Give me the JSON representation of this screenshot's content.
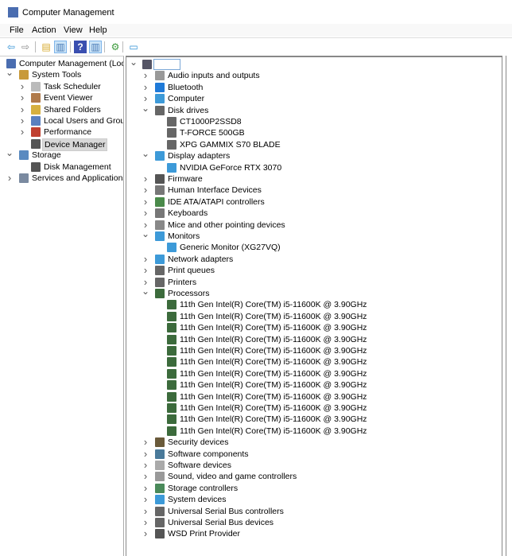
{
  "window": {
    "title": "Computer Management"
  },
  "menu": [
    "File",
    "Action",
    "View",
    "Help"
  ],
  "toolbar": [
    {
      "icon": "back-arrow-icon",
      "glyph": "⇦",
      "color": "#2d8fd5"
    },
    {
      "icon": "forward-arrow-icon",
      "glyph": "⇨",
      "color": "#888"
    },
    {
      "icon": "up-folder-icon",
      "glyph": "▤",
      "color": "#d6a82a"
    },
    {
      "icon": "show-hide-console-tree-icon",
      "glyph": "▥",
      "color": "#4a7bb7",
      "pressed": true
    },
    {
      "icon": "help-icon",
      "glyph": "?",
      "color": "#fff",
      "bg": "#3a4fb0"
    },
    {
      "icon": "show-hide-action-pane-icon",
      "glyph": "▥",
      "color": "#4a7bb7",
      "pressed": true
    },
    {
      "icon": "update-driver-icon",
      "glyph": "⚙",
      "color": "#3a9a3a"
    },
    {
      "icon": "scan-hardware-icon",
      "glyph": "▭",
      "color": "#2d8fd5"
    }
  ],
  "left_tree": [
    {
      "level": 0,
      "exp": "",
      "icon": "computer-management-icon",
      "color": "#4a6db0",
      "label": "Computer Management (Local"
    },
    {
      "level": 1,
      "exp": "open",
      "icon": "system-tools-icon",
      "color": "#c89a3a",
      "label": "System Tools"
    },
    {
      "level": 2,
      "exp": "closed",
      "icon": "task-scheduler-icon",
      "color": "#bbb",
      "label": "Task Scheduler"
    },
    {
      "level": 2,
      "exp": "closed",
      "icon": "event-viewer-icon",
      "color": "#b07a4a",
      "label": "Event Viewer"
    },
    {
      "level": 2,
      "exp": "closed",
      "icon": "shared-folders-icon",
      "color": "#d6b040",
      "label": "Shared Folders"
    },
    {
      "level": 2,
      "exp": "closed",
      "icon": "local-users-icon",
      "color": "#5a80c0",
      "label": "Local Users and Groups"
    },
    {
      "level": 2,
      "exp": "closed",
      "icon": "performance-icon",
      "color": "#c04030",
      "label": "Performance"
    },
    {
      "level": 2,
      "exp": "",
      "icon": "device-manager-icon",
      "color": "#555",
      "label": "Device Manager",
      "selected": true
    },
    {
      "level": 1,
      "exp": "open",
      "icon": "storage-icon",
      "color": "#5a8ac0",
      "label": "Storage"
    },
    {
      "level": 2,
      "exp": "",
      "icon": "disk-management-icon",
      "color": "#555",
      "label": "Disk Management"
    },
    {
      "level": 1,
      "exp": "closed",
      "icon": "services-applications-icon",
      "color": "#7a8aa0",
      "label": "Services and Applications"
    }
  ],
  "device_tree": [
    {
      "level": 0,
      "exp": "open",
      "icon": "computer-root-icon",
      "color": "#556",
      "label": ""
    },
    {
      "level": 1,
      "exp": "closed",
      "icon": "speaker-icon",
      "color": "#999",
      "label": "Audio inputs and outputs"
    },
    {
      "level": 1,
      "exp": "closed",
      "icon": "bluetooth-icon",
      "color": "#1f7ad8",
      "label": "Bluetooth"
    },
    {
      "level": 1,
      "exp": "closed",
      "icon": "monitor-icon",
      "color": "#3d9ad8",
      "label": "Computer"
    },
    {
      "level": 1,
      "exp": "open",
      "icon": "disk-drive-icon",
      "color": "#666",
      "label": "Disk drives"
    },
    {
      "level": 2,
      "exp": "",
      "icon": "disk-drive-icon",
      "color": "#666",
      "label": "CT1000P2SSD8"
    },
    {
      "level": 2,
      "exp": "",
      "icon": "disk-drive-icon",
      "color": "#666",
      "label": "T-FORCE 500GB"
    },
    {
      "level": 2,
      "exp": "",
      "icon": "disk-drive-icon",
      "color": "#666",
      "label": "XPG GAMMIX S70 BLADE"
    },
    {
      "level": 1,
      "exp": "open",
      "icon": "display-adapter-icon",
      "color": "#3d9ad8",
      "label": "Display adapters"
    },
    {
      "level": 2,
      "exp": "",
      "icon": "display-adapter-icon",
      "color": "#3d9ad8",
      "label": "NVIDIA GeForce RTX 3070"
    },
    {
      "level": 1,
      "exp": "closed",
      "icon": "firmware-icon",
      "color": "#555",
      "label": "Firmware"
    },
    {
      "level": 1,
      "exp": "closed",
      "icon": "hid-icon",
      "color": "#777",
      "label": "Human Interface Devices"
    },
    {
      "level": 1,
      "exp": "closed",
      "icon": "ide-controller-icon",
      "color": "#4a8a4a",
      "label": "IDE ATA/ATAPI controllers"
    },
    {
      "level": 1,
      "exp": "closed",
      "icon": "keyboard-icon",
      "color": "#777",
      "label": "Keyboards"
    },
    {
      "level": 1,
      "exp": "closed",
      "icon": "mouse-icon",
      "color": "#888",
      "label": "Mice and other pointing devices"
    },
    {
      "level": 1,
      "exp": "open",
      "icon": "monitor-icon",
      "color": "#3d9ad8",
      "label": "Monitors"
    },
    {
      "level": 2,
      "exp": "",
      "icon": "monitor-icon",
      "color": "#3d9ad8",
      "label": "Generic Monitor (XG27VQ)"
    },
    {
      "level": 1,
      "exp": "closed",
      "icon": "network-adapter-icon",
      "color": "#3d9ad8",
      "label": "Network adapters"
    },
    {
      "level": 1,
      "exp": "closed",
      "icon": "print-queue-icon",
      "color": "#666",
      "label": "Print queues"
    },
    {
      "level": 1,
      "exp": "closed",
      "icon": "printer-icon",
      "color": "#666",
      "label": "Printers"
    },
    {
      "level": 1,
      "exp": "open",
      "icon": "processor-icon",
      "color": "#3c6b3c",
      "label": "Processors"
    },
    {
      "level": 2,
      "exp": "",
      "icon": "processor-icon",
      "color": "#3c6b3c",
      "label": "11th Gen Intel(R) Core(TM) i5-11600K @ 3.90GHz"
    },
    {
      "level": 2,
      "exp": "",
      "icon": "processor-icon",
      "color": "#3c6b3c",
      "label": "11th Gen Intel(R) Core(TM) i5-11600K @ 3.90GHz"
    },
    {
      "level": 2,
      "exp": "",
      "icon": "processor-icon",
      "color": "#3c6b3c",
      "label": "11th Gen Intel(R) Core(TM) i5-11600K @ 3.90GHz"
    },
    {
      "level": 2,
      "exp": "",
      "icon": "processor-icon",
      "color": "#3c6b3c",
      "label": "11th Gen Intel(R) Core(TM) i5-11600K @ 3.90GHz"
    },
    {
      "level": 2,
      "exp": "",
      "icon": "processor-icon",
      "color": "#3c6b3c",
      "label": "11th Gen Intel(R) Core(TM) i5-11600K @ 3.90GHz"
    },
    {
      "level": 2,
      "exp": "",
      "icon": "processor-icon",
      "color": "#3c6b3c",
      "label": "11th Gen Intel(R) Core(TM) i5-11600K @ 3.90GHz"
    },
    {
      "level": 2,
      "exp": "",
      "icon": "processor-icon",
      "color": "#3c6b3c",
      "label": "11th Gen Intel(R) Core(TM) i5-11600K @ 3.90GHz"
    },
    {
      "level": 2,
      "exp": "",
      "icon": "processor-icon",
      "color": "#3c6b3c",
      "label": "11th Gen Intel(R) Core(TM) i5-11600K @ 3.90GHz"
    },
    {
      "level": 2,
      "exp": "",
      "icon": "processor-icon",
      "color": "#3c6b3c",
      "label": "11th Gen Intel(R) Core(TM) i5-11600K @ 3.90GHz"
    },
    {
      "level": 2,
      "exp": "",
      "icon": "processor-icon",
      "color": "#3c6b3c",
      "label": "11th Gen Intel(R) Core(TM) i5-11600K @ 3.90GHz"
    },
    {
      "level": 2,
      "exp": "",
      "icon": "processor-icon",
      "color": "#3c6b3c",
      "label": "11th Gen Intel(R) Core(TM) i5-11600K @ 3.90GHz"
    },
    {
      "level": 2,
      "exp": "",
      "icon": "processor-icon",
      "color": "#3c6b3c",
      "label": "11th Gen Intel(R) Core(TM) i5-11600K @ 3.90GHz"
    },
    {
      "level": 1,
      "exp": "closed",
      "icon": "security-device-icon",
      "color": "#6a5a3a",
      "label": "Security devices"
    },
    {
      "level": 1,
      "exp": "closed",
      "icon": "software-component-icon",
      "color": "#4a7a9a",
      "label": "Software components"
    },
    {
      "level": 1,
      "exp": "closed",
      "icon": "software-device-icon",
      "color": "#aaa",
      "label": "Software devices"
    },
    {
      "level": 1,
      "exp": "closed",
      "icon": "speaker-icon",
      "color": "#999",
      "label": "Sound, video and game controllers"
    },
    {
      "level": 1,
      "exp": "closed",
      "icon": "storage-controller-icon",
      "color": "#4a8a5a",
      "label": "Storage controllers"
    },
    {
      "level": 1,
      "exp": "closed",
      "icon": "system-device-icon",
      "color": "#3d9ad8",
      "label": "System devices"
    },
    {
      "level": 1,
      "exp": "closed",
      "icon": "usb-icon",
      "color": "#666",
      "label": "Universal Serial Bus controllers"
    },
    {
      "level": 1,
      "exp": "closed",
      "icon": "usb-icon",
      "color": "#666",
      "label": "Universal Serial Bus devices"
    },
    {
      "level": 1,
      "exp": "closed",
      "icon": "wsd-printer-icon",
      "color": "#555",
      "label": "WSD Print Provider"
    }
  ]
}
